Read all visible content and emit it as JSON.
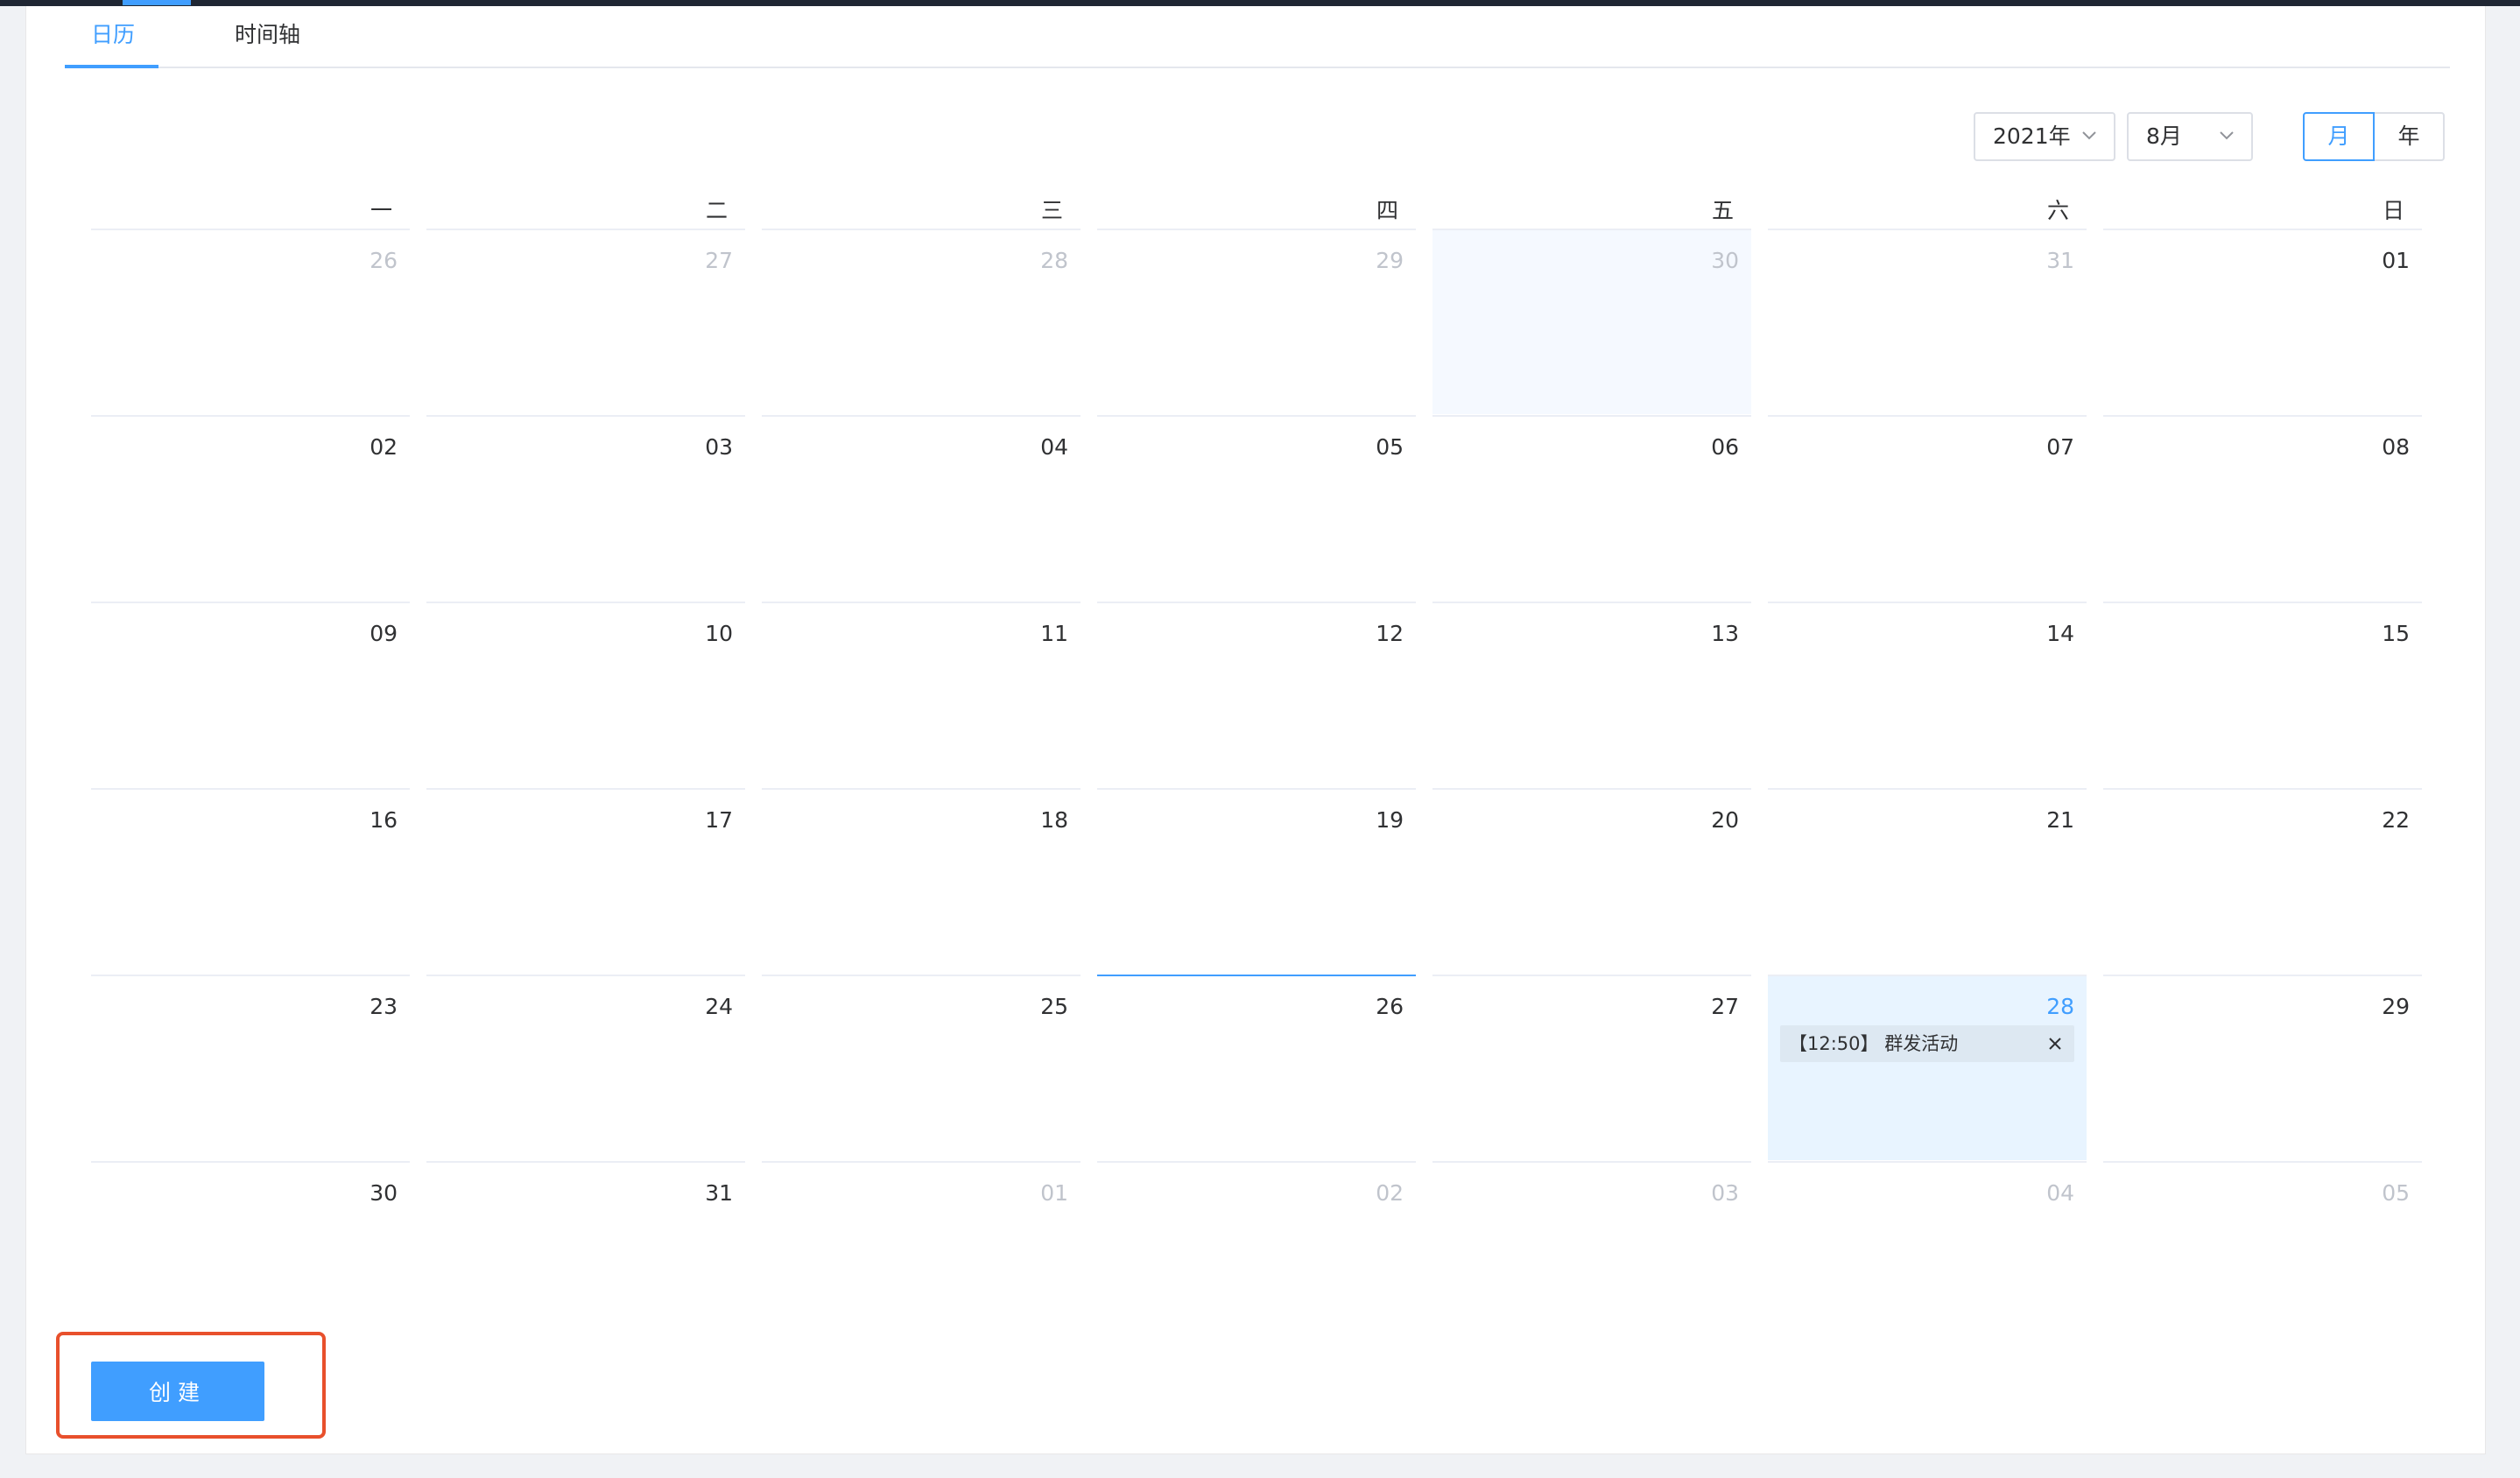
{
  "tabs": [
    {
      "label": "日历",
      "active": true
    },
    {
      "label": "时间轴",
      "active": false
    }
  ],
  "header": {
    "year_select": "2021年",
    "month_select": "8月",
    "view_month": "月",
    "view_year": "年"
  },
  "calendar": {
    "weekdays": [
      "一",
      "二",
      "三",
      "四",
      "五",
      "六",
      "日"
    ],
    "weeks": [
      [
        {
          "d": "26",
          "o": true
        },
        {
          "d": "27",
          "o": true
        },
        {
          "d": "28",
          "o": true
        },
        {
          "d": "29",
          "o": true
        },
        {
          "d": "30",
          "o": true,
          "hover": true
        },
        {
          "d": "31",
          "o": true
        },
        {
          "d": "01"
        }
      ],
      [
        {
          "d": "02"
        },
        {
          "d": "03"
        },
        {
          "d": "04"
        },
        {
          "d": "05"
        },
        {
          "d": "06"
        },
        {
          "d": "07"
        },
        {
          "d": "08"
        }
      ],
      [
        {
          "d": "09"
        },
        {
          "d": "10"
        },
        {
          "d": "11"
        },
        {
          "d": "12"
        },
        {
          "d": "13"
        },
        {
          "d": "14"
        },
        {
          "d": "15"
        }
      ],
      [
        {
          "d": "16"
        },
        {
          "d": "17"
        },
        {
          "d": "18"
        },
        {
          "d": "19"
        },
        {
          "d": "20"
        },
        {
          "d": "21"
        },
        {
          "d": "22"
        }
      ],
      [
        {
          "d": "23"
        },
        {
          "d": "24"
        },
        {
          "d": "25"
        },
        {
          "d": "26",
          "today": true
        },
        {
          "d": "27"
        },
        {
          "d": "28",
          "selected": true,
          "event": "【12:50】 群发活动"
        },
        {
          "d": "29"
        }
      ],
      [
        {
          "d": "30"
        },
        {
          "d": "31"
        },
        {
          "d": "01",
          "o": true
        },
        {
          "d": "02",
          "o": true
        },
        {
          "d": "03",
          "o": true
        },
        {
          "d": "04",
          "o": true
        },
        {
          "d": "05",
          "o": true
        }
      ]
    ]
  },
  "actions": {
    "create_label": "创建"
  },
  "colors": {
    "primary": "#409eff",
    "highlight_border": "#e8502c",
    "selected_cell": "#e8f4ff",
    "event_bg": "#dde8f2"
  }
}
